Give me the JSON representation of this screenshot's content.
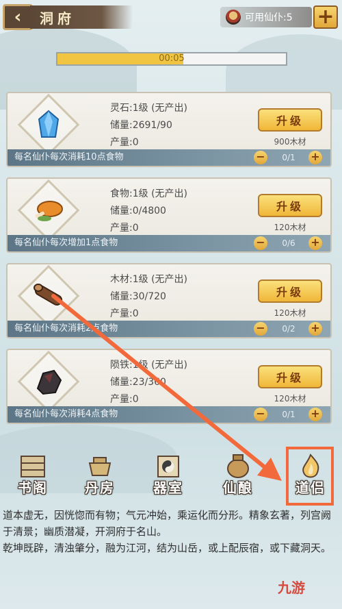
{
  "header": {
    "title": "洞府",
    "servant_label": "可用仙仆:5",
    "add_symbol": "+"
  },
  "progress": {
    "text": "00:05",
    "fill_fraction": 0.55
  },
  "cards": [
    {
      "icon": "spirit-stone-icon",
      "name_level": "灵石:1级 (无产出)",
      "storage": "储量:2691/90",
      "output": "产量:0",
      "upgrade_label": "升级",
      "cost": "900木材",
      "footer": "每名仙仆每次消耗10点食物",
      "slots": "0/1"
    },
    {
      "icon": "food-drumstick-icon",
      "name_level": "食物:1级 (无产出)",
      "storage": "储量:0/4800",
      "output": "产量:0",
      "upgrade_label": "升级",
      "cost": "120木材",
      "footer": "每名仙仆每次增加1点食物",
      "slots": "0/6"
    },
    {
      "icon": "wood-log-icon",
      "name_level": "木材:1级 (无产出)",
      "storage": "储量:30/720",
      "output": "产量:0",
      "upgrade_label": "升级",
      "cost": "120木材",
      "footer": "每名仙仆每次消耗2点食物",
      "slots": "0/2"
    },
    {
      "icon": "meteoric-iron-icon",
      "name_level": "陨铁:1级 (无产出)",
      "storage": "储量:23/360",
      "output": "产量:0",
      "upgrade_label": "升级",
      "cost": "120木材",
      "footer": "每名仙仆每次消耗4点食物",
      "slots": "0/1"
    }
  ],
  "nav": [
    {
      "label": "书阁",
      "icon": "bookshelf-icon"
    },
    {
      "label": "丹房",
      "icon": "cauldron-icon"
    },
    {
      "label": "器室",
      "icon": "scroll-taiji-icon"
    },
    {
      "label": "仙酿",
      "icon": "wine-jar-icon"
    },
    {
      "label": "道侣",
      "icon": "flame-icon"
    }
  ],
  "lore": [
    "道本虚无，因恍惚而有物；气元冲始，乘运化而分形。精象玄著，列宫阙于清景；幽质潜凝，开洞府于名山。",
    "乾坤既辟，清浊肇分，融为江河，结为山岳，或上配辰宿，或下藏洞天。"
  ],
  "watermark": "九游",
  "colors": {
    "accent": "#f26a3b",
    "button_gold": "#f0b638",
    "footer_blue": "#5d7687"
  }
}
